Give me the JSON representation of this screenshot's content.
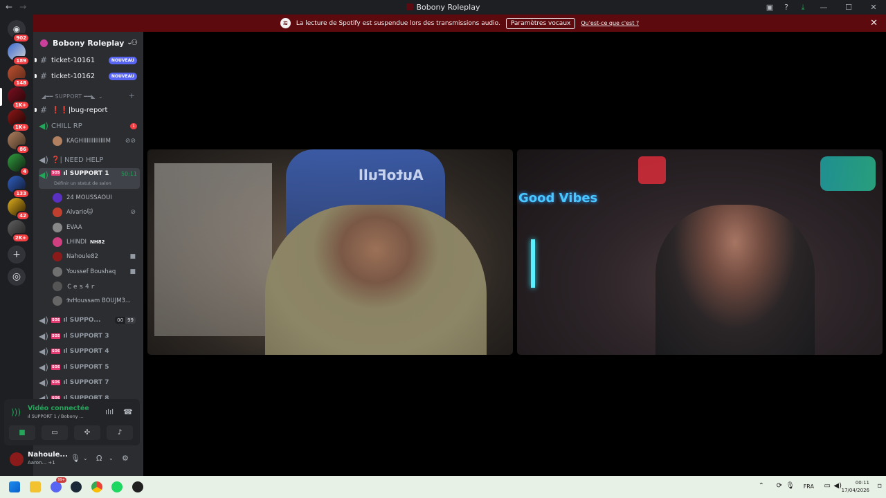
{
  "window": {
    "title": "Bobony Roleplay"
  },
  "banner": {
    "text": "La lecture de Spotify est suspendue lors des transmissions audio.",
    "button": "Paramètres vocaux",
    "link": "Qu'est-ce que c'est ?"
  },
  "guilds": [
    {
      "badge": "902"
    },
    {
      "badge": "189"
    },
    {
      "badge": "148"
    },
    {
      "badge": "1K+"
    },
    {
      "badge": "1K+"
    },
    {
      "badge": "86"
    },
    {
      "badge": "4"
    },
    {
      "badge": "133"
    },
    {
      "badge": "42"
    },
    {
      "badge": "2K+"
    }
  ],
  "server": {
    "name": "Bobony Roleplay"
  },
  "channels": {
    "ticket1": "ticket-10161",
    "ticket2": "ticket-10162",
    "new": "NOUVEAU",
    "cat_support": "◢━━ SUPPORT ━━◣",
    "bugreport": "❗❗|bug-report",
    "chillrp": "CHILL RP",
    "chill_badge": "1",
    "chill_user": "KAGHIIIIIIIIIIIIIM",
    "needhelp": "❓| NEED HELP",
    "support1": "ıl SUPPORT 1",
    "support1_time": "50:11",
    "support1_status": "Définir un statut de salon",
    "users": [
      "24 MOUSSAOUI",
      "Alvario🐱",
      "EVAA",
      "LHINDI",
      "Nahoule82",
      "Youssef Boushaq",
      "Ｃｅｓ４ｒ",
      "𝕯𝖗Houssam BOUJM3..."
    ],
    "lhindi_tag": "NH82",
    "support2": "ıl SUPPO...",
    "support2_a": "00",
    "support2_b": "99",
    "support3": "ıl SUPPORT 3",
    "support4": "ıl SUPPORT 4",
    "support5": "ıl SUPPORT 5",
    "support7": "ıl SUPPORT 7",
    "support8": "ıl SUPPORT 8"
  },
  "voice_panel": {
    "status": "Vidéo connectée",
    "channel": "ıl SUPPORT 1 / Bobony ..."
  },
  "user": {
    "name": "Nahoule...",
    "activity": "Aaron... +1"
  },
  "video_tiles": [
    {
      "overlay_text": "AutoFull"
    },
    {
      "overlay_text": "Good Vibes"
    }
  ],
  "taskbar": {
    "lang": "FRA",
    "time": "00:11",
    "date": "17/04/2026",
    "discord_badge": "99+"
  }
}
